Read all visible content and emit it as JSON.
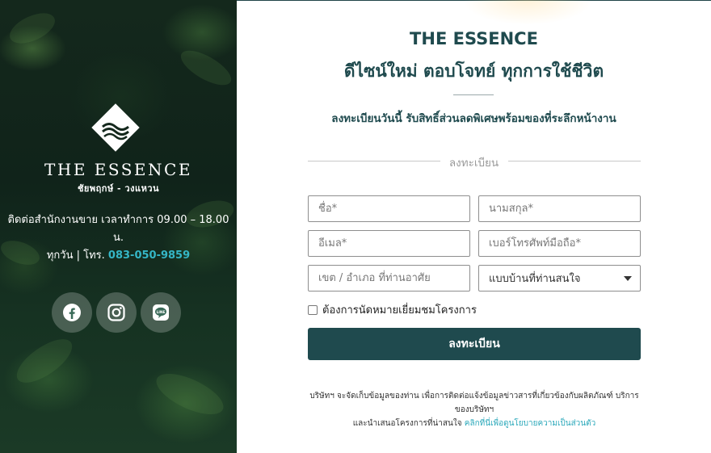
{
  "left_panel": {
    "brand_name": "THE ESSENCE",
    "brand_sub": "ชัยพฤกษ์ - วงแหวน",
    "contact_line1": "ติดต่อสำนักงานขาย เวลาทำการ 09.00 – 18.00 น.",
    "contact_line2_prefix": "ทุกวัน | โทร. ",
    "phone": "083-050-9859",
    "socials": [
      {
        "name": "facebook",
        "icon": "facebook-icon"
      },
      {
        "name": "instagram",
        "icon": "instagram-icon"
      },
      {
        "name": "line",
        "icon": "line-icon"
      }
    ],
    "accent_color": "#35b6c6"
  },
  "form": {
    "title": "THE ESSENCE",
    "subtitle": "ดีไซน์ใหม่ ตอบโจทย์ ทุกการใช้ชีวิต",
    "promo": "ลงทะเบียนวันนี้ รับสิทธิ์ส่วนลดพิเศษพร้อมของที่ระลึกหน้างาน",
    "section_label": "ลงทะเบียน",
    "fields": {
      "first_name": {
        "placeholder": "ชื่อ*",
        "value": ""
      },
      "last_name": {
        "placeholder": "นามสกุล*",
        "value": ""
      },
      "email": {
        "placeholder": "อีเมล*",
        "value": ""
      },
      "phone": {
        "placeholder": "เบอร์โทรศัพท์มือถือ*",
        "value": ""
      },
      "district": {
        "placeholder": "เขต / อำเภอ ที่ท่านอาศัย",
        "value": ""
      },
      "house_type": {
        "selected": "แบบบ้านที่ท่านสนใจ"
      }
    },
    "appointment_checkbox": {
      "label": "ต้องการนัดหมายเยี่ยมชมโครงการ",
      "checked": false
    },
    "submit_label": "ลงทะเบียน",
    "footnote_line1": "บริษัทฯ จะจัดเก็บข้อมูลของท่าน เพื่อการติดต่อแจ้งข้อมูลข่าวสารที่เกี่ยวข้องกับผลิตภัณฑ์ บริการของบริษัทฯ",
    "footnote_line2_prefix": "และนำเสนอโครงการที่น่าสนใจ ",
    "footnote_link": "คลิกที่นี่เพื่อดูนโยบายความเป็นส่วนตัว",
    "primary_color": "#1f4a4e"
  }
}
